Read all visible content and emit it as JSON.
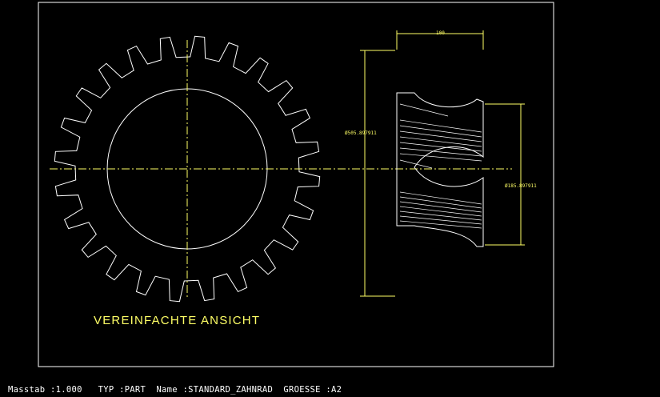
{
  "drawing": {
    "caption": "VEREINFACHTE ANSICHT",
    "dim_width": "100",
    "dim_outer_diameter": "Ø505.897911",
    "dim_inner_diameter": "Ø185.897911"
  },
  "status_bar": {
    "scale_label": "Masstab :",
    "scale_value": "1.000",
    "type_label": "TYP :",
    "type_value": "PART",
    "name_label": "Name :",
    "name_value": "STANDARD_ZAHNRAD",
    "size_label": "GROESSE :",
    "size_value": "A2"
  },
  "gear": {
    "teeth": 24
  },
  "colors": {
    "background": "#000000",
    "geometry": "#ffffff",
    "dimension": "#ffff66",
    "centerline": "#ffff66"
  }
}
